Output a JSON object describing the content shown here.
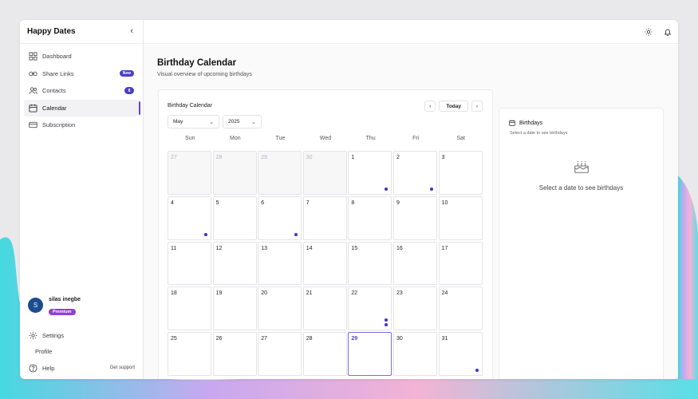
{
  "app": {
    "title": "Happy Dates",
    "collapse_icon": "chevron-left-icon"
  },
  "sidebar": {
    "items": [
      {
        "label": "Dashboard",
        "icon": "dashboard-icon"
      },
      {
        "label": "Share Links",
        "icon": "link-icon",
        "badge": "New"
      },
      {
        "label": "Contacts",
        "icon": "users-icon",
        "badge": "8"
      },
      {
        "label": "Calendar",
        "icon": "calendar-icon",
        "active": true
      },
      {
        "label": "Subscription",
        "icon": "credit-card-icon"
      }
    ],
    "user": {
      "initial": "S",
      "name": "silas inegbe",
      "plan": "Premium"
    },
    "settings_label": "Settings",
    "profile_label": "Profile",
    "help_label": "Help",
    "support_label": "Get support"
  },
  "topbar": {
    "icons": [
      "sun-icon",
      "bell-icon"
    ]
  },
  "page": {
    "title": "Birthday Calendar",
    "subtitle": "Visual overview of upcoming birthdays"
  },
  "calendar": {
    "title": "Birthday Calendar",
    "today_label": "Today",
    "month": "May",
    "year": "2025",
    "weekdays": [
      "Sun",
      "Mon",
      "Tue",
      "Wed",
      "Thu",
      "Fri",
      "Sat"
    ],
    "days": [
      {
        "n": "27",
        "muted": true
      },
      {
        "n": "28",
        "muted": true
      },
      {
        "n": "29",
        "muted": true
      },
      {
        "n": "30",
        "muted": true
      },
      {
        "n": "1",
        "dots": 1
      },
      {
        "n": "2",
        "dots": 1
      },
      {
        "n": "3"
      },
      {
        "n": "4",
        "dots": 1
      },
      {
        "n": "5"
      },
      {
        "n": "6",
        "dots": 1
      },
      {
        "n": "7"
      },
      {
        "n": "8"
      },
      {
        "n": "9"
      },
      {
        "n": "10"
      },
      {
        "n": "11"
      },
      {
        "n": "12"
      },
      {
        "n": "13"
      },
      {
        "n": "14"
      },
      {
        "n": "15"
      },
      {
        "n": "16"
      },
      {
        "n": "17"
      },
      {
        "n": "18"
      },
      {
        "n": "19"
      },
      {
        "n": "20"
      },
      {
        "n": "21"
      },
      {
        "n": "22",
        "dots": 2
      },
      {
        "n": "23"
      },
      {
        "n": "24"
      },
      {
        "n": "25"
      },
      {
        "n": "26"
      },
      {
        "n": "27"
      },
      {
        "n": "28"
      },
      {
        "n": "29",
        "today": true
      },
      {
        "n": "30"
      },
      {
        "n": "31",
        "dots": 1
      }
    ]
  },
  "birthdays": {
    "title": "Birthdays",
    "subtitle": "Select a date to see birthdays",
    "empty_text": "Select a date to see birthdays"
  },
  "colors": {
    "accent": "#6d3fd8",
    "dot": "#3a35c7",
    "badge": "#4a3ec9",
    "premium": "#8f3fd6",
    "avatar": "#1b4d8f"
  }
}
